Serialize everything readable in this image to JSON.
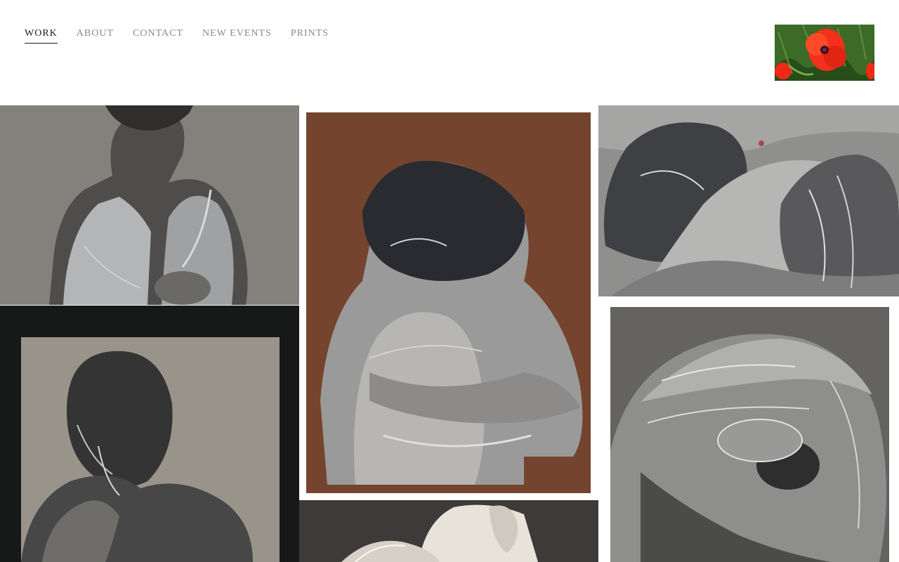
{
  "nav": {
    "items": [
      {
        "label": "WORK",
        "active": true
      },
      {
        "label": "ABOUT",
        "active": false
      },
      {
        "label": "CONTACT",
        "active": false
      },
      {
        "label": "NEW EVENTS",
        "active": false
      },
      {
        "label": "PRINTS",
        "active": false
      }
    ]
  },
  "logo": {
    "icon": "red-poppy-photo"
  },
  "gallery": {
    "artworks": [
      {
        "icon": "embracing-couple-gray-artwork"
      },
      {
        "icon": "embracing-couple-rust-artwork"
      },
      {
        "icon": "kissing-couple-artwork"
      },
      {
        "icon": "framed-figure-artwork"
      },
      {
        "icon": "bearded-face-artwork"
      },
      {
        "icon": "ear-and-hair-artwork"
      }
    ]
  },
  "colors": {
    "nav_active": "#1d1d1d",
    "nav_inactive": "#8a8a8a",
    "poppy_red": "#f2301b",
    "foliage_green": "#2f5a1f",
    "rust_background": "#6a3d29"
  }
}
